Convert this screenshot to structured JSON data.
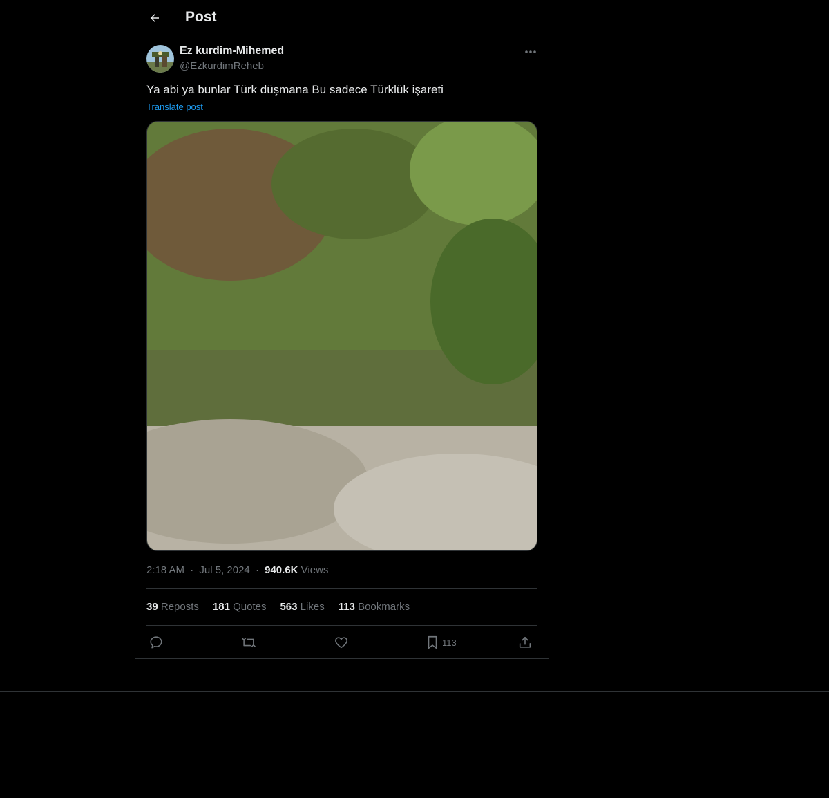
{
  "header": {
    "title": "Post"
  },
  "author": {
    "name": "Ez kurdim-Mihemed",
    "handle": "@EzkurdimReheb"
  },
  "post": {
    "text": "Ya abi ya bunlar Türk düşmana Bu sadece Türklük işareti",
    "translate_label": "Translate post"
  },
  "meta": {
    "time": "2:18 AM",
    "dot1": "·",
    "date": "Jul 5, 2024",
    "dot2": "·",
    "views_count": "940.6K",
    "views_label": "Views"
  },
  "stats": {
    "reposts_count": "39",
    "reposts_label": "Reposts",
    "quotes_count": "181",
    "quotes_label": "Quotes",
    "likes_count": "563",
    "likes_label": "Likes",
    "bookmarks_count": "113",
    "bookmarks_label": "Bookmarks"
  },
  "actions": {
    "bookmark_count": "113"
  },
  "icons": [
    "back-arrow-icon",
    "more-icon",
    "reply-icon",
    "repost-icon",
    "like-icon",
    "bookmark-icon",
    "share-icon"
  ],
  "colors": {
    "background": "#000000",
    "text": "#e7e9ea",
    "muted": "#71767b",
    "link": "#1d9bf0",
    "border": "#2f3336"
  }
}
